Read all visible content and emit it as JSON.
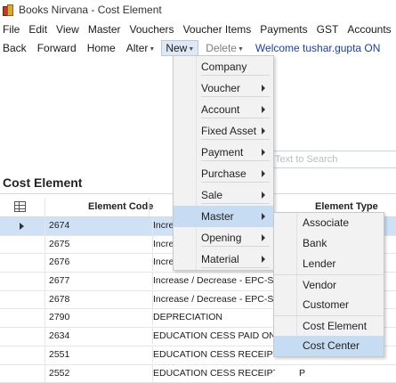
{
  "window": {
    "title": "Books Nirvana - Cost Element"
  },
  "menubar": [
    "File",
    "Edit",
    "View",
    "Master",
    "Vouchers",
    "Voucher Items",
    "Payments",
    "GST",
    "Accounts",
    "I"
  ],
  "toolbar": {
    "back": "Back",
    "forward": "Forward",
    "home": "Home",
    "alter": "Alter",
    "new": "New",
    "delete": "Delete",
    "welcome": "Welcome tushar.gupta ON"
  },
  "search": {
    "placeholder": "Text to Search"
  },
  "page": {
    "title": "Cost Element"
  },
  "grid": {
    "headers": {
      "code": "Element Code",
      "type": "Element Type"
    },
    "rows": [
      {
        "code": "2674",
        "name": "Increase / Decrease - EPC-Salary",
        "type": "",
        "selected": true
      },
      {
        "code": "2675",
        "name": "Increase / Decrease - EPC-Salary",
        "type": ""
      },
      {
        "code": "2676",
        "name": "Increase / Decrease - EPC-Salary",
        "type": ""
      },
      {
        "code": "2677",
        "name": "Increase / Decrease - EPC-Salary",
        "type": ""
      },
      {
        "code": "2678",
        "name": "Increase / Decrease - EPC-Salary",
        "type": ""
      },
      {
        "code": "2790",
        "name": "DEPRECIATION",
        "type": ""
      },
      {
        "code": "2634",
        "name": "EDUCATION CESS PAID ON",
        "type": ""
      },
      {
        "code": "2551",
        "name": "EDUCATION CESS  RECEIPT",
        "type": ""
      },
      {
        "code": "2552",
        "name": "EDUCATION CESS RECEIPTS O",
        "type": "P"
      }
    ]
  },
  "new_menu": {
    "items": [
      {
        "label": "Company",
        "arrow": false
      },
      {
        "label": "Voucher",
        "arrow": true
      },
      {
        "label": "Account",
        "arrow": true
      },
      {
        "label": "Fixed Asset",
        "arrow": true
      },
      {
        "label": "Payment",
        "arrow": true
      },
      {
        "label": "Purchase",
        "arrow": true
      },
      {
        "label": "Sale",
        "arrow": true
      },
      {
        "label": "Master",
        "arrow": true,
        "hover": true
      },
      {
        "label": "Opening",
        "arrow": true
      },
      {
        "label": "Material",
        "arrow": true
      }
    ]
  },
  "master_submenu": {
    "items": [
      {
        "label": "Associate"
      },
      {
        "label": "Bank"
      },
      {
        "label": "Lender"
      },
      {
        "label": "Vendor"
      },
      {
        "label": "Customer"
      },
      {
        "label": "Cost Element"
      },
      {
        "label": "Cost Center",
        "hover": true
      }
    ]
  },
  "colors": {
    "accent": "#1b3fa8",
    "selection": "#cfe2f5",
    "menu_hover": "#c6dcf2",
    "menu_bg": "#f2f2f2"
  }
}
